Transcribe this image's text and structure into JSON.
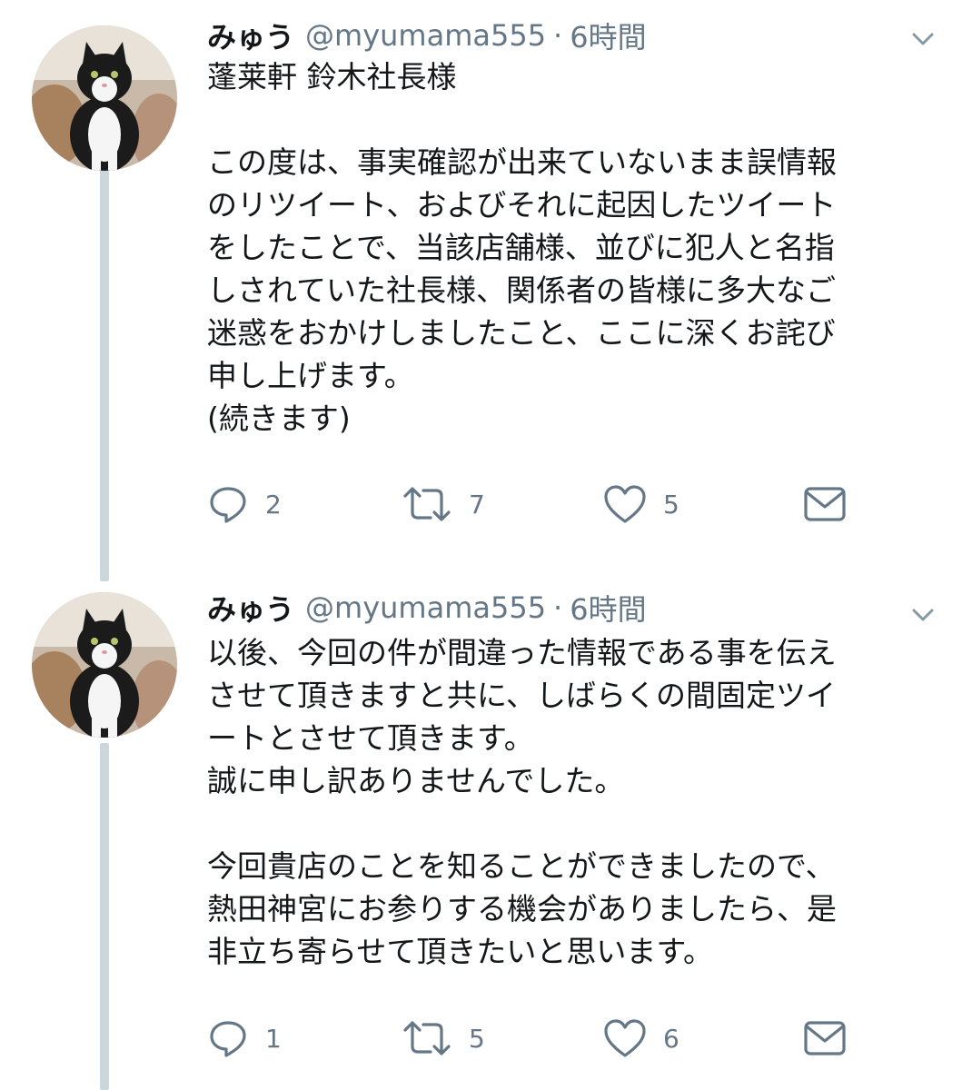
{
  "tweets": [
    {
      "name": "みゅう",
      "handle": "@myumama555",
      "separator": "·",
      "time": "6時間",
      "avatar_icon": "cat-avatar-icon",
      "lines": [
        "蓬莱軒 鈴木社長様",
        "",
        "この度は、事実確認が出来ていないまま誤情報",
        "のリツイート、およびそれに起因したツイート",
        "をしたことで、当該店舗様、並びに犯人と名指",
        "しされていた社長様、関係者の皆様に多大なご",
        "迷惑をおかけしましたこと、ここに深くお詫び",
        "申し上げます。",
        "(続きます)"
      ],
      "reply_count": "2",
      "retweet_count": "7",
      "like_count": "5"
    },
    {
      "name": "みゅう",
      "handle": "@myumama555",
      "separator": "·",
      "time": "6時間",
      "avatar_icon": "cat-avatar-icon",
      "lines": [
        "以後、今回の件が間違った情報である事を伝え",
        "させて頂きますと共に、しばらくの間固定ツイ",
        "ートとさせて頂きます。",
        "誠に申し訳ありませんでした。",
        "",
        "今回貴店のことを知ることができましたので、",
        "熱田神宮にお参りする機会がありましたら、是",
        "非立ち寄らせて頂きたいと思います。"
      ],
      "reply_count": "1",
      "retweet_count": "5",
      "like_count": "6"
    }
  ],
  "icons": {
    "caret": "chevron-down-icon",
    "reply": "reply-icon",
    "retweet": "retweet-icon",
    "like": "heart-icon",
    "dm": "envelope-icon"
  },
  "colors": {
    "text": "#14171a",
    "secondary": "#657786",
    "thread_line": "#ccd6dd",
    "icon": "#657786"
  }
}
